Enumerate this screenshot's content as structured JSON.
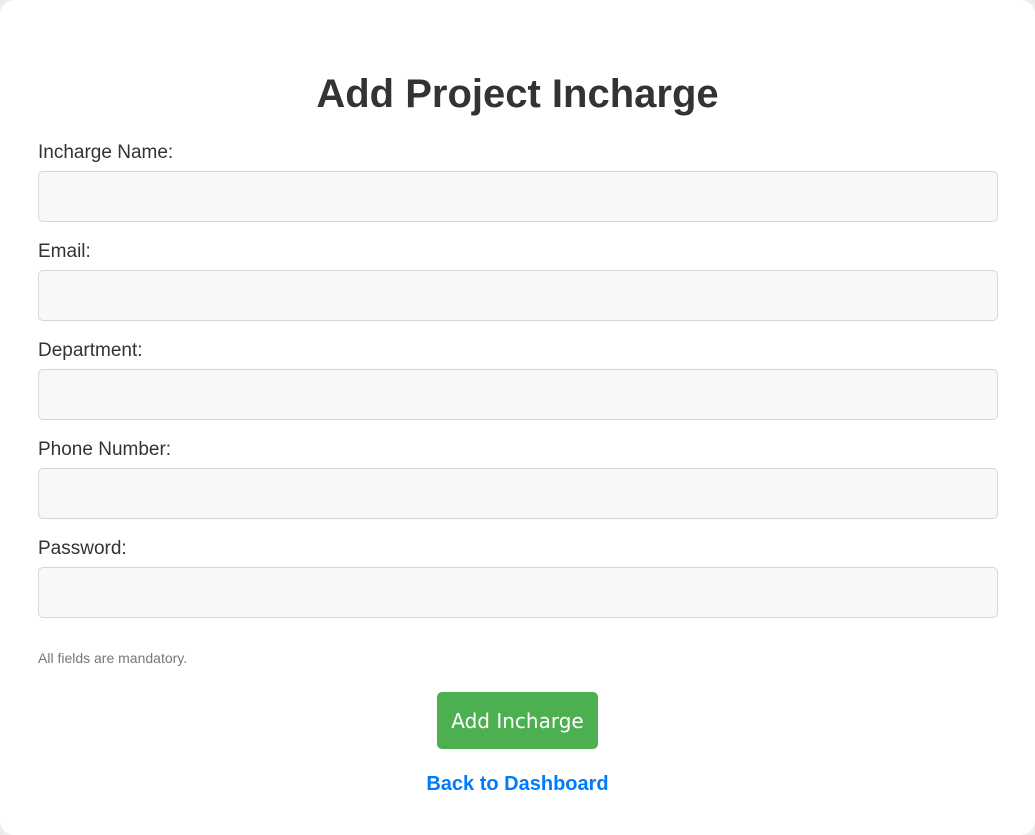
{
  "title": "Add Project Incharge",
  "fields": [
    {
      "label": "Incharge Name:",
      "value": "",
      "placeholder": ""
    },
    {
      "label": "Email:",
      "value": "",
      "placeholder": ""
    },
    {
      "label": "Department:",
      "value": "",
      "placeholder": ""
    },
    {
      "label": "Phone Number:",
      "value": "",
      "placeholder": ""
    },
    {
      "label": "Password:",
      "value": "",
      "placeholder": ""
    }
  ],
  "note": "All fields are mandatory.",
  "submit_label": "Add Incharge",
  "back_link": "Back to Dashboard",
  "colors": {
    "accent": "#4caf50",
    "link": "#007bff"
  }
}
